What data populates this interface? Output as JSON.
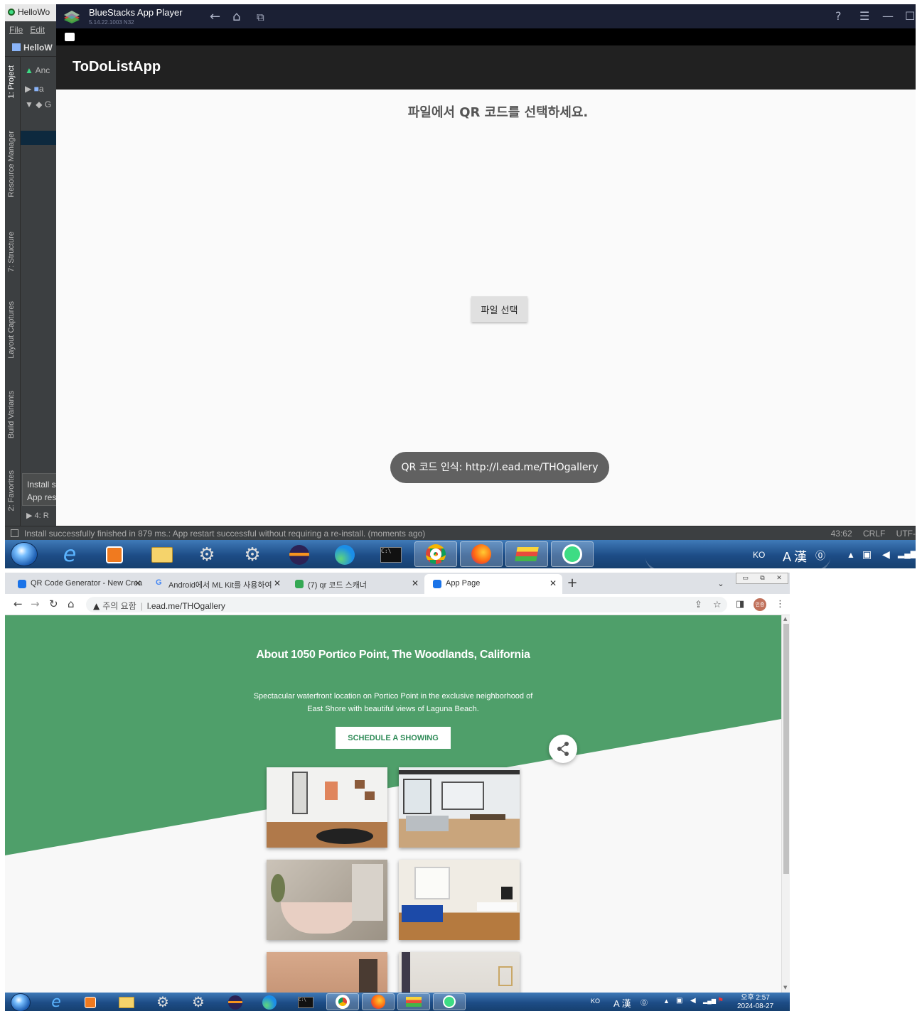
{
  "android_studio": {
    "title": "HelloWo",
    "menu": [
      "File",
      "Edit"
    ],
    "project_name": "HelloW",
    "tool_tabs": [
      "1: Project",
      "Resource Manager",
      "7: Structure",
      "Layout Captures",
      "Build Variants",
      "2: Favorites"
    ],
    "tree_rows": [
      "Anc",
      "a",
      "G"
    ],
    "popup_line1": "Install s",
    "popup_line2": "App res",
    "run_tab": "4: R",
    "status_message": "Install successfully finished in 879 ms.: App restart successful without requiring a re-install. (moments ago)",
    "status_position": "43:62",
    "status_line_sep": "CRLF",
    "status_encoding": "UTF-"
  },
  "bluestacks": {
    "title": "BlueStacks App Player",
    "version": "5.14.22.1003 N32"
  },
  "app": {
    "title": "ToDoListApp",
    "heading": "파일에서 QR 코드를 선택하세요.",
    "select_file_button": "파일 선택",
    "toast": "QR 코드 인식: http://l.ead.me/THOgallery"
  },
  "taskbar": {
    "lang": "KO",
    "ime": "A 漢",
    "clock_time": "오후 2:57",
    "clock_date": "2024-08-27"
  },
  "browser": {
    "tabs": [
      {
        "label": "QR Code Generator - New Crea"
      },
      {
        "label": "Android에서 ML Kit를 사용하여"
      },
      {
        "label": "(7) qr 코드 스캐너"
      },
      {
        "label": "App Page"
      }
    ],
    "insecure_label": "주의 요함",
    "url": "l.ead.me/THOgallery",
    "avatar_label": "인증"
  },
  "webpage": {
    "heading": "About 1050 Portico Point, The Woodlands, California",
    "description": "Spectacular waterfront location on Portico Point in the exclusive neighborhood of East Shore with beautiful views of Laguna Beach.",
    "cta": "SCHEDULE A SHOWING"
  },
  "colors": {
    "green": "#4f9f6a",
    "app_bar": "#212121",
    "toast": "#616161",
    "taskbar": "#1d4c86",
    "bluestacks": "#1b2034"
  },
  "icons": [
    "back-arrow-icon",
    "home-icon",
    "recent-apps-icon",
    "help-icon",
    "menu-icon",
    "share-icon",
    "star-icon",
    "reload-icon"
  ]
}
